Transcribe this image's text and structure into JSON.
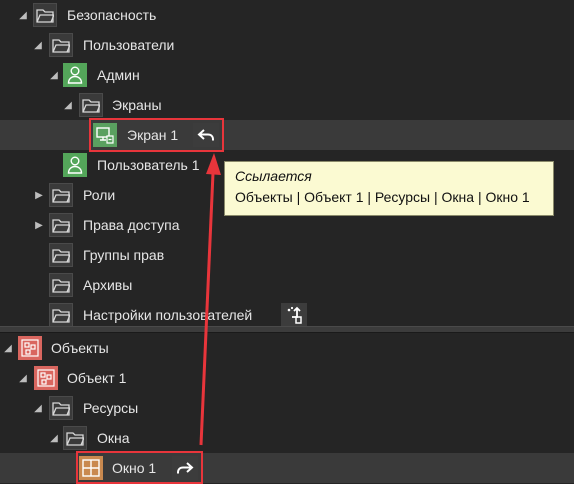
{
  "security_tree": {
    "security": "Безопасность",
    "users": "Пользователи",
    "admin": "Админ",
    "screens": "Экраны",
    "screen1": "Экран 1",
    "user1": "Пользователь 1",
    "roles": "Роли",
    "access_rights": "Права доступа",
    "rights_groups": "Группы прав",
    "archives": "Архивы",
    "user_settings": "Настройки пользователей"
  },
  "objects_tree": {
    "objects": "Объекты",
    "object1": "Объект 1",
    "resources": "Ресурсы",
    "windows": "Окна",
    "window1": "Окно 1"
  },
  "tooltip": {
    "title": "Ссылается",
    "path": "Объекты | Объект 1 | Ресурсы | Окна | Окно 1"
  },
  "colors": {
    "background": "#252525",
    "highlight": "#e8353b",
    "user_icon": "#54a65a",
    "object_icon": "#d9665f",
    "window_icon": "#c9894f",
    "tooltip_bg": "#fbfad2"
  },
  "icons": {
    "folder": "folder-icon",
    "user": "user-icon",
    "object": "object-icon",
    "screen": "screen-icon",
    "window": "window-icon",
    "reference_back": "undo-arrow-icon",
    "reference_forward": "redo-arrow-icon",
    "settings_action": "corner-arrow-icon"
  }
}
